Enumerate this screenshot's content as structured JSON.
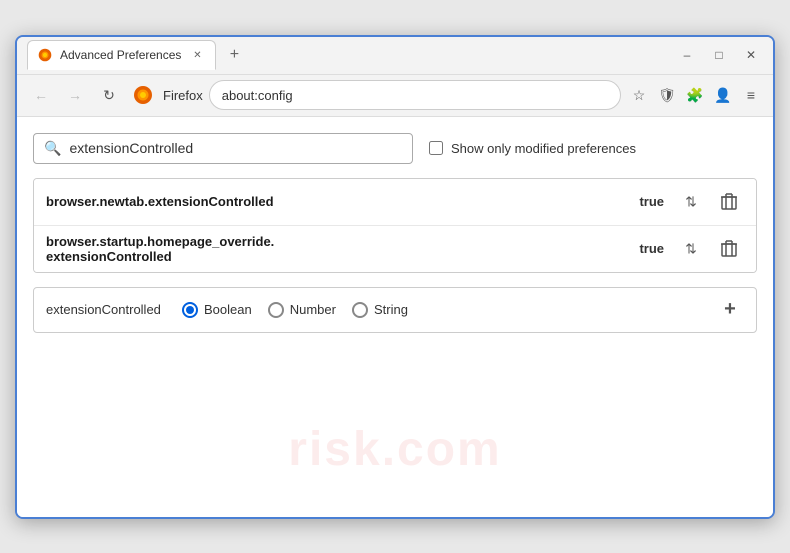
{
  "window": {
    "title": "Advanced Preferences",
    "new_tab_icon": "+",
    "minimize": "–",
    "maximize": "□",
    "close": "✕"
  },
  "toolbar": {
    "back_icon": "←",
    "forward_icon": "→",
    "reload_icon": "↻",
    "browser_name": "Firefox",
    "address": "about:config",
    "star_icon": "☆",
    "shield_icon": "🛡",
    "ext_icon": "🧩",
    "profile_icon": "👤",
    "settings_icon": "≡"
  },
  "search": {
    "placeholder": "extensionControlled",
    "value": "extensionControlled",
    "show_modified_label": "Show only modified preferences"
  },
  "preferences": [
    {
      "name": "browser.newtab.extensionControlled",
      "value": "true"
    },
    {
      "name_line1": "browser.startup.homepage_override.",
      "name_line2": "extensionControlled",
      "value": "true"
    }
  ],
  "add_preference": {
    "name": "extensionControlled",
    "type_options": [
      {
        "label": "Boolean",
        "selected": true
      },
      {
        "label": "Number",
        "selected": false
      },
      {
        "label": "String",
        "selected": false
      }
    ]
  },
  "watermark": "risk.com"
}
